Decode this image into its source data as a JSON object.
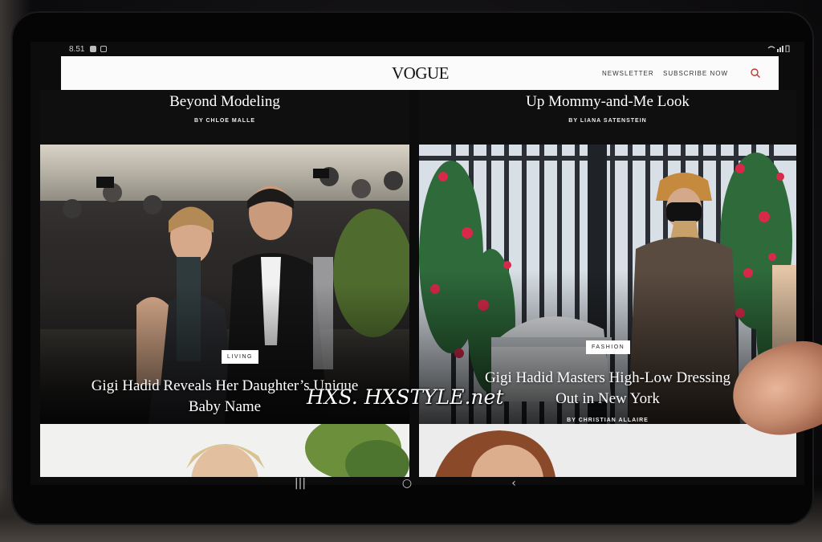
{
  "status_bar": {
    "time": "8.51"
  },
  "header": {
    "logo": "VOGUE",
    "newsletter_label": "NEWSLETTER",
    "subscribe_label": "SUBSCRIBE NOW"
  },
  "articles_top": [
    {
      "title": "Beyond Modeling",
      "byline": "BY CHLOE MALLE"
    },
    {
      "title": "Up Mommy-and-Me Look",
      "byline": "BY LIANA SATENSTEIN"
    }
  ],
  "articles_main": [
    {
      "tag": "LIVING",
      "title_line1": "Gigi Hadid Reveals Her Daughter’s Unique",
      "title_line2": "Baby Name"
    },
    {
      "tag": "FASHION",
      "title_line1": "Gigi Hadid Masters High-Low Dressing",
      "title_line2": "Out in New York",
      "byline": "BY CHRISTIAN ALLAIRE"
    }
  ],
  "watermark": "HXS. HXSTYLE.net",
  "softkeys": {
    "recents": "|||",
    "home": "○",
    "back": "‹"
  },
  "colors": {
    "header_bg": "#fbfbfb",
    "search_accent": "#c0392b",
    "overlay_text": "#ffffff"
  }
}
